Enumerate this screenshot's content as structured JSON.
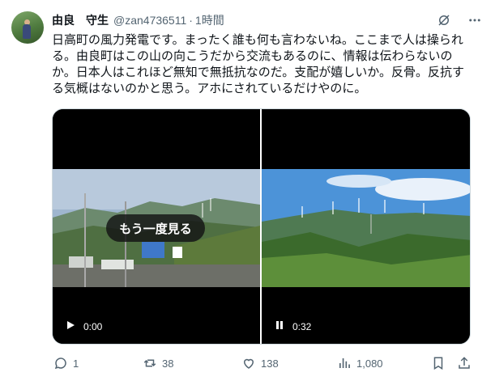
{
  "tweet": {
    "author_name": "由良　守生",
    "handle": "@zan4736511",
    "separator": "·",
    "time": "1時間",
    "text_lines": [
      "日高町の風力発電です。まったく誰も何も言わないね。ここまで人は操られ",
      "る。由良町はこの山の向こうだから交流もあるのに、情報は伝わらないの",
      "か。日本人はこれほど無知で無抵抗なのだ。支配が嬉しいか。反骨。反抗す",
      "る気概はないのかと思う。アホにされているだけやのに。"
    ]
  },
  "media": {
    "left_video": {
      "replay_label": "もう一度見る",
      "timestamp": "0:00",
      "state": "play-icon"
    },
    "right_video": {
      "timestamp": "0:32",
      "state": "pause-icon"
    }
  },
  "actions": {
    "replies": "1",
    "retweets": "38",
    "likes": "138",
    "views": "1,080"
  },
  "colors": {
    "text": "#0f1419",
    "secondary": "#536471",
    "border": "#cfd9de"
  }
}
